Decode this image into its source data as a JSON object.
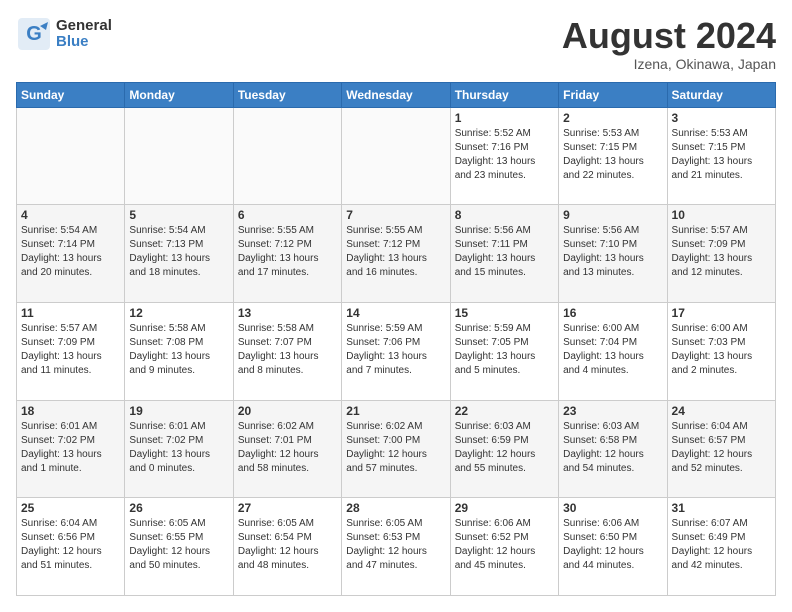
{
  "header": {
    "logo": {
      "general": "General",
      "blue": "Blue"
    },
    "title": "August 2024",
    "location": "Izena, Okinawa, Japan"
  },
  "calendar": {
    "days_of_week": [
      "Sunday",
      "Monday",
      "Tuesday",
      "Wednesday",
      "Thursday",
      "Friday",
      "Saturday"
    ],
    "weeks": [
      [
        {
          "day": "",
          "info": ""
        },
        {
          "day": "",
          "info": ""
        },
        {
          "day": "",
          "info": ""
        },
        {
          "day": "",
          "info": ""
        },
        {
          "day": "1",
          "info": "Sunrise: 5:52 AM\nSunset: 7:16 PM\nDaylight: 13 hours\nand 23 minutes."
        },
        {
          "day": "2",
          "info": "Sunrise: 5:53 AM\nSunset: 7:15 PM\nDaylight: 13 hours\nand 22 minutes."
        },
        {
          "day": "3",
          "info": "Sunrise: 5:53 AM\nSunset: 7:15 PM\nDaylight: 13 hours\nand 21 minutes."
        }
      ],
      [
        {
          "day": "4",
          "info": "Sunrise: 5:54 AM\nSunset: 7:14 PM\nDaylight: 13 hours\nand 20 minutes."
        },
        {
          "day": "5",
          "info": "Sunrise: 5:54 AM\nSunset: 7:13 PM\nDaylight: 13 hours\nand 18 minutes."
        },
        {
          "day": "6",
          "info": "Sunrise: 5:55 AM\nSunset: 7:12 PM\nDaylight: 13 hours\nand 17 minutes."
        },
        {
          "day": "7",
          "info": "Sunrise: 5:55 AM\nSunset: 7:12 PM\nDaylight: 13 hours\nand 16 minutes."
        },
        {
          "day": "8",
          "info": "Sunrise: 5:56 AM\nSunset: 7:11 PM\nDaylight: 13 hours\nand 15 minutes."
        },
        {
          "day": "9",
          "info": "Sunrise: 5:56 AM\nSunset: 7:10 PM\nDaylight: 13 hours\nand 13 minutes."
        },
        {
          "day": "10",
          "info": "Sunrise: 5:57 AM\nSunset: 7:09 PM\nDaylight: 13 hours\nand 12 minutes."
        }
      ],
      [
        {
          "day": "11",
          "info": "Sunrise: 5:57 AM\nSunset: 7:09 PM\nDaylight: 13 hours\nand 11 minutes."
        },
        {
          "day": "12",
          "info": "Sunrise: 5:58 AM\nSunset: 7:08 PM\nDaylight: 13 hours\nand 9 minutes."
        },
        {
          "day": "13",
          "info": "Sunrise: 5:58 AM\nSunset: 7:07 PM\nDaylight: 13 hours\nand 8 minutes."
        },
        {
          "day": "14",
          "info": "Sunrise: 5:59 AM\nSunset: 7:06 PM\nDaylight: 13 hours\nand 7 minutes."
        },
        {
          "day": "15",
          "info": "Sunrise: 5:59 AM\nSunset: 7:05 PM\nDaylight: 13 hours\nand 5 minutes."
        },
        {
          "day": "16",
          "info": "Sunrise: 6:00 AM\nSunset: 7:04 PM\nDaylight: 13 hours\nand 4 minutes."
        },
        {
          "day": "17",
          "info": "Sunrise: 6:00 AM\nSunset: 7:03 PM\nDaylight: 13 hours\nand 2 minutes."
        }
      ],
      [
        {
          "day": "18",
          "info": "Sunrise: 6:01 AM\nSunset: 7:02 PM\nDaylight: 13 hours\nand 1 minute."
        },
        {
          "day": "19",
          "info": "Sunrise: 6:01 AM\nSunset: 7:02 PM\nDaylight: 13 hours\nand 0 minutes."
        },
        {
          "day": "20",
          "info": "Sunrise: 6:02 AM\nSunset: 7:01 PM\nDaylight: 12 hours\nand 58 minutes."
        },
        {
          "day": "21",
          "info": "Sunrise: 6:02 AM\nSunset: 7:00 PM\nDaylight: 12 hours\nand 57 minutes."
        },
        {
          "day": "22",
          "info": "Sunrise: 6:03 AM\nSunset: 6:59 PM\nDaylight: 12 hours\nand 55 minutes."
        },
        {
          "day": "23",
          "info": "Sunrise: 6:03 AM\nSunset: 6:58 PM\nDaylight: 12 hours\nand 54 minutes."
        },
        {
          "day": "24",
          "info": "Sunrise: 6:04 AM\nSunset: 6:57 PM\nDaylight: 12 hours\nand 52 minutes."
        }
      ],
      [
        {
          "day": "25",
          "info": "Sunrise: 6:04 AM\nSunset: 6:56 PM\nDaylight: 12 hours\nand 51 minutes."
        },
        {
          "day": "26",
          "info": "Sunrise: 6:05 AM\nSunset: 6:55 PM\nDaylight: 12 hours\nand 50 minutes."
        },
        {
          "day": "27",
          "info": "Sunrise: 6:05 AM\nSunset: 6:54 PM\nDaylight: 12 hours\nand 48 minutes."
        },
        {
          "day": "28",
          "info": "Sunrise: 6:05 AM\nSunset: 6:53 PM\nDaylight: 12 hours\nand 47 minutes."
        },
        {
          "day": "29",
          "info": "Sunrise: 6:06 AM\nSunset: 6:52 PM\nDaylight: 12 hours\nand 45 minutes."
        },
        {
          "day": "30",
          "info": "Sunrise: 6:06 AM\nSunset: 6:50 PM\nDaylight: 12 hours\nand 44 minutes."
        },
        {
          "day": "31",
          "info": "Sunrise: 6:07 AM\nSunset: 6:49 PM\nDaylight: 12 hours\nand 42 minutes."
        }
      ]
    ]
  }
}
